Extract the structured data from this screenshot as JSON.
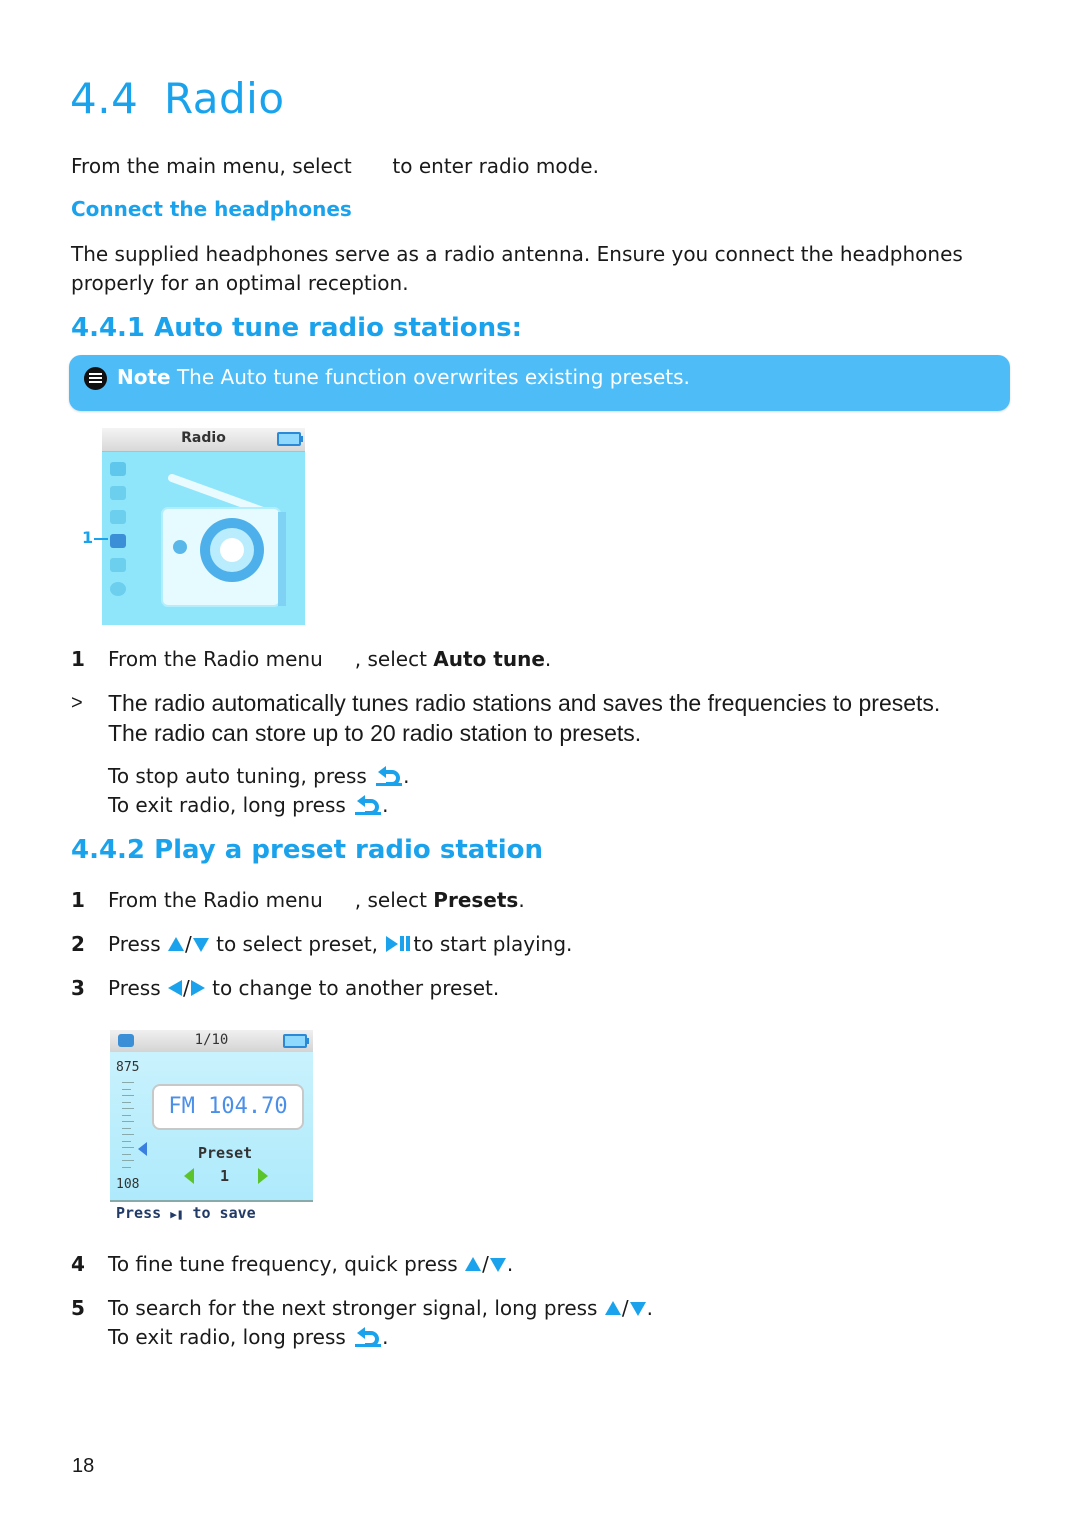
{
  "page": {
    "section_number": "4.4",
    "section_title": "Radio",
    "intro_before": "From the main menu, select",
    "intro_after": "to enter radio mode.",
    "connect_heading": "Connect the headphones",
    "connect_text_line1": "The supplied headphones serve as a radio antenna. Ensure you connect the headphones",
    "connect_text_line2": "properly for an optimal reception.",
    "page_number": "18"
  },
  "auto_tune": {
    "heading": "4.4.1 Auto tune radio stations:",
    "note_label": "Note",
    "note_text": "The Auto tune function overwrites existing presets.",
    "screen": {
      "title": "Radio",
      "callout": "1"
    },
    "step1_num": "1",
    "step1_before": "From the Radio menu",
    "step1_mid": ", select",
    "step1_bold": "Auto tune",
    "step1_end": ".",
    "result_marker": ">",
    "result_line1": "The radio automatically tunes radio stations and saves the frequencies to presets.",
    "result_line2": "The radio can store up to 20 radio station to presets.",
    "stop_text": "To stop auto tuning, press",
    "exit_text": "To exit radio, long press",
    "period": "."
  },
  "preset": {
    "heading": "4.4.2 Play a preset radio station",
    "steps": [
      {
        "num": "1",
        "before": "From the Radio menu",
        "mid": ", select",
        "bold": "Presets",
        "end": "."
      },
      {
        "num": "2",
        "before": "Press",
        "sep": "/",
        "mid": "to select preset,",
        "end": "to start playing."
      },
      {
        "num": "3",
        "before": "Press",
        "sep": "/",
        "end": "to change to another preset."
      },
      {
        "num": "4",
        "before": "To fine tune frequency, quick press",
        "sep": "/",
        "end": "."
      },
      {
        "num": "5",
        "before": "To search for the next stronger signal, long press",
        "sep": "/",
        "end": ".",
        "line2": "To exit radio, long press"
      }
    ],
    "screen": {
      "counter": "1/10",
      "scale_top": "875",
      "scale_bottom": "108",
      "frequency": "FM 104.70",
      "preset_label": "Preset",
      "preset_number": "1",
      "save_hint_before": "Press",
      "save_hint_after": "to save"
    }
  },
  "colors": {
    "accent": "#1aa3ec",
    "note_bg": "#4ebdf7",
    "text": "#1a1a1a"
  }
}
